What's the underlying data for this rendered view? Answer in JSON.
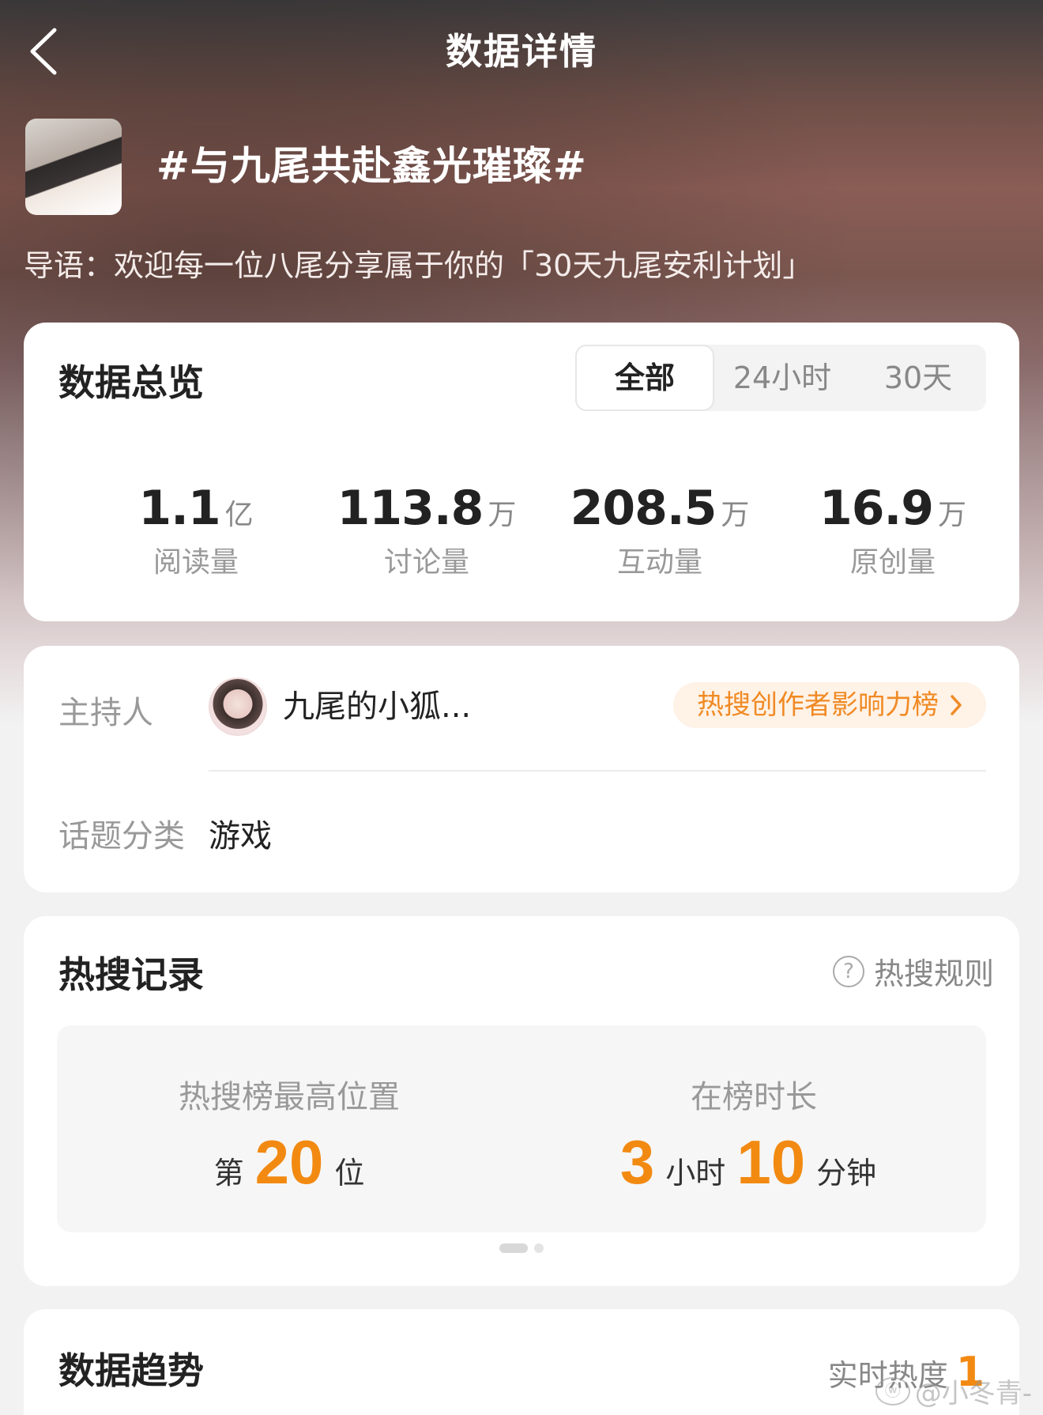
{
  "header": {
    "title": "数据详情"
  },
  "topic": {
    "title": "#与九尾共赴鑫光璀璨#",
    "intro": "导语：欢迎每一位八尾分享属于你的「30天九尾安利计划」"
  },
  "overview": {
    "heading": "数据总览",
    "tabs": [
      "全部",
      "24小时",
      "30天"
    ],
    "active_tab": "全部",
    "stats": [
      {
        "value": "1.1",
        "unit": "亿",
        "label": "阅读量"
      },
      {
        "value": "113.8",
        "unit": "万",
        "label": "讨论量"
      },
      {
        "value": "208.5",
        "unit": "万",
        "label": "互动量"
      },
      {
        "value": "16.9",
        "unit": "万",
        "label": "原创量"
      }
    ]
  },
  "host": {
    "label": "主持人",
    "name": "九尾的小狐...",
    "influence_button": "热搜创作者影响力榜",
    "category_label": "话题分类",
    "category_value": "游戏"
  },
  "hot": {
    "heading": "热搜记录",
    "rules_label": "热搜规则",
    "best_label": "热搜榜最高位置",
    "best_prefix": "第",
    "best_value": "20",
    "best_suffix": "位",
    "duration_label": "在榜时长",
    "hours_value": "3",
    "hours_unit": "小时",
    "minutes_value": "10",
    "minutes_unit": "分钟"
  },
  "trend": {
    "heading": "数据趋势",
    "realtime_label": "实时热度",
    "realtime_value": "1"
  },
  "watermark": {
    "text": "@小冬青-"
  },
  "colors": {
    "accent": "#f28a12",
    "influence_text": "#f08a24",
    "influence_bg": "#fff2e6"
  }
}
